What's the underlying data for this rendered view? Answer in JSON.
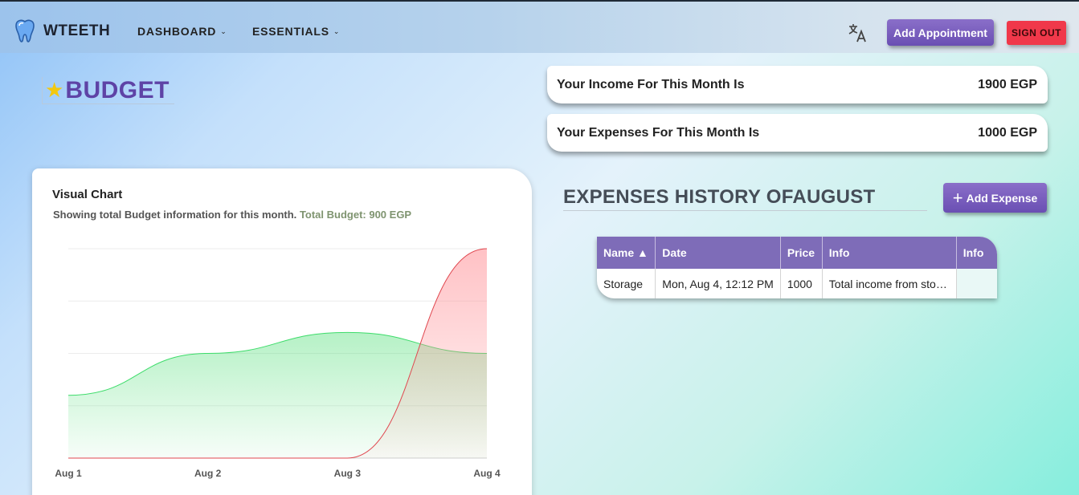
{
  "navbar": {
    "brand": "WTEETH",
    "menus": [
      {
        "label": "DASHBOARD"
      },
      {
        "label": "ESSENTIALS"
      }
    ],
    "add_appointment": "Add Appointment",
    "sign_out": "SIGN OUT"
  },
  "page": {
    "title": "BUDGET"
  },
  "summary": {
    "income_label": "Your Income For This Month Is",
    "income_value": "1900 EGP",
    "expenses_label": "Your Expenses For This Month Is",
    "expenses_value": "1000 EGP"
  },
  "chart_card": {
    "title": "Visual Chart",
    "subtitle": "Showing total Budget information for this month.",
    "total": "Total Budget: 900 EGP"
  },
  "chart_data": {
    "type": "area",
    "x": [
      "Aug 1",
      "Aug 2",
      "Aug 3",
      "Aug 4"
    ],
    "series": [
      {
        "values": [
          1200,
          2000,
          2400,
          2000
        ],
        "color": "#3ddc6a"
      },
      {
        "values": [
          0,
          0,
          0,
          4000
        ],
        "color": "#e0474f"
      }
    ],
    "ylim": [
      0,
      4000
    ],
    "grid": true
  },
  "expenses": {
    "title": "EXPENSES HISTORY OFAUGUST",
    "add_button": "Add Expense",
    "columns": [
      "Name ▲",
      "Date",
      "Price",
      "Info",
      "Info"
    ],
    "rows": [
      [
        "Storage",
        "Mon, Aug 4, 12:12 PM",
        "1000",
        "Total income from sto…",
        ""
      ]
    ]
  },
  "colors": {
    "accent": "#6a4fb3",
    "danger": "#f0384a",
    "star": "#f3c80f"
  }
}
